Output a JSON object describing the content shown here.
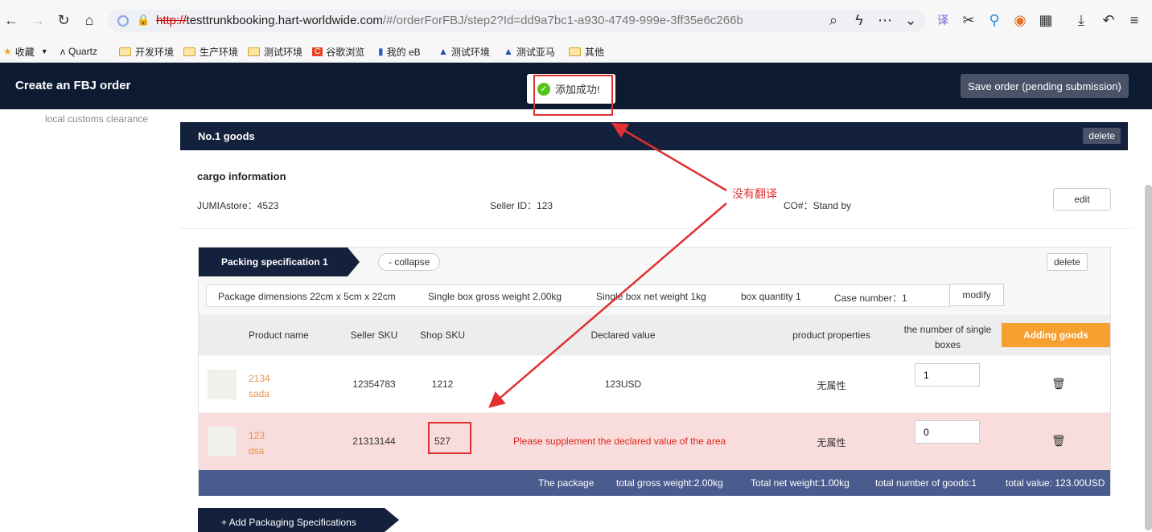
{
  "browser": {
    "url_protocol": "http://",
    "url_host": "testtrunkbooking.hart-worldwide.com",
    "url_path": "/#/orderForFBJ/step2?Id=dd9a7bc1-a930-4749-999e-3ff35e6c266b",
    "bookmarks": [
      "收藏",
      "Quartz",
      "开发环境",
      "生产环境",
      "测试环境",
      "谷歌浏览",
      "我的 eB",
      "测试环境",
      "测试亚马",
      "其他"
    ]
  },
  "header": {
    "title": "Create an FBJ order",
    "save_label": "Save order (pending submission)"
  },
  "toast": {
    "text": "添加成功!"
  },
  "sidebar": {
    "step_text": "local customs clearance"
  },
  "goods": {
    "title": "No.1 goods",
    "delete_label": "delete",
    "cargo_title": "cargo information",
    "jumia_store": "JUMIAstore：4523",
    "seller_id": "Seller ID：123",
    "co_number": "CO#：Stand by",
    "edit_label": "edit"
  },
  "spec": {
    "tab_label": "Packing specification 1",
    "collapse_label": "- collapse",
    "delete_label": "delete",
    "dimensions": "Package dimensions 22cm x 5cm x 22cm",
    "gross_weight": "Single box gross weight 2.00kg",
    "net_weight": "Single box net weight 1kg",
    "box_quantity": "box quantity 1",
    "case_number": "Case number：1",
    "modify_label": "modify",
    "add_goods_label": "Adding goods",
    "add_spec_label": "+ Add Packaging Specifications"
  },
  "table": {
    "headers": {
      "product_name": "Product name",
      "seller_sku": "Seller SKU",
      "shop_sku": "Shop SKU",
      "declared_value": "Declared value",
      "properties": "product properties",
      "single_boxes": "the number of single boxes"
    },
    "rows": [
      {
        "name_line1": "2134",
        "name_line2": "sada",
        "seller_sku": "12354783",
        "shop_sku": "1212",
        "declared": "123USD",
        "properties": "无属性",
        "qty": "1"
      },
      {
        "name_line1": "123",
        "name_line2": "dsa",
        "seller_sku": "21313144",
        "shop_sku": "527",
        "declared": "Please supplement the declared value of the area",
        "properties": "无属性",
        "qty": "0"
      }
    ]
  },
  "summary": {
    "package": "The package",
    "gross": "total gross weight:2.00kg",
    "net": "Total net weight:1.00kg",
    "goods": "total number of goods:1",
    "value": "total value: 123.00USD"
  },
  "annotation": {
    "text": "没有翻译"
  },
  "colors": {
    "nav_dark": "#0d1b32",
    "accent_orange": "#f5a031",
    "error_red": "#d9261c",
    "summary_blue": "#4a5b8e"
  }
}
